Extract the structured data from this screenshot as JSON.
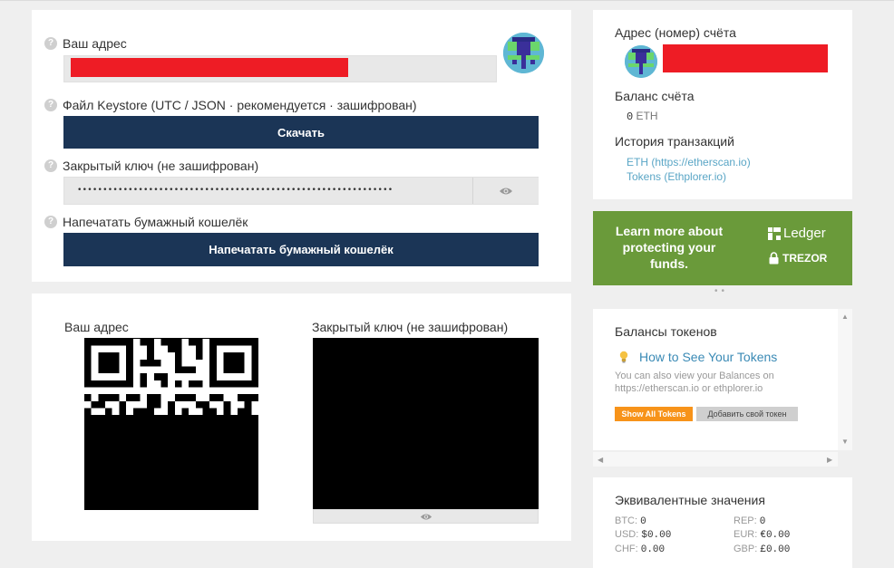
{
  "wallet": {
    "address_label": "Ваш адрес",
    "keystore_label": "Файл Keystore (UTC / JSON · рекомендуется · зашифрован)",
    "download_button": "Скачать",
    "private_key_label": "Закрытый ключ (не зашифрован)",
    "private_key_masked": "••••••••••••••••••••••••••••••••••••••••••••••••••••••••••••••",
    "print_label": "Напечатать бумажный кошелёк",
    "print_button": "Напечатать бумажный кошелёк",
    "help_icon": "question-icon",
    "eye_icon": "eye-icon"
  },
  "qr": {
    "address_label": "Ваш адрес",
    "private_key_label": "Закрытый ключ (не зашифрован)"
  },
  "account": {
    "address_title": "Адрес (номер) счёта",
    "balance_title": "Баланс счёта",
    "balance_value": "0",
    "balance_unit": "ETH",
    "history_title": "История транзакций",
    "history_eth": "ETH (https://etherscan.io)",
    "history_tokens": "Tokens (Ethplorer.io)"
  },
  "promo": {
    "text": "Learn more about protecting your funds.",
    "ledger": "Ledger",
    "trezor": "TREZOR",
    "bg_color": "#6a9a3a"
  },
  "tokens": {
    "title": "Балансы токенов",
    "how_to": "How to See Your Tokens",
    "desc": "You can also view your Balances on https://etherscan.io or ethplorer.io",
    "show_all": "Show All Tokens",
    "add_token": "Добавить свой токен"
  },
  "equiv": {
    "title": "Эквивалентные значения",
    "rows": [
      {
        "l_label": "BTC:",
        "l_val": "0",
        "r_label": "REP:",
        "r_val": "0"
      },
      {
        "l_label": "USD:",
        "l_val": "$0.00",
        "r_label": "EUR:",
        "r_val": "€0.00"
      },
      {
        "l_label": "CHF:",
        "l_val": "0.00",
        "r_label": "GBP:",
        "r_val": "£0.00"
      }
    ]
  },
  "colors": {
    "navy": "#1b3556",
    "redaction": "#ee1c25",
    "orange": "#f7931a",
    "link": "#5aa6c6"
  }
}
